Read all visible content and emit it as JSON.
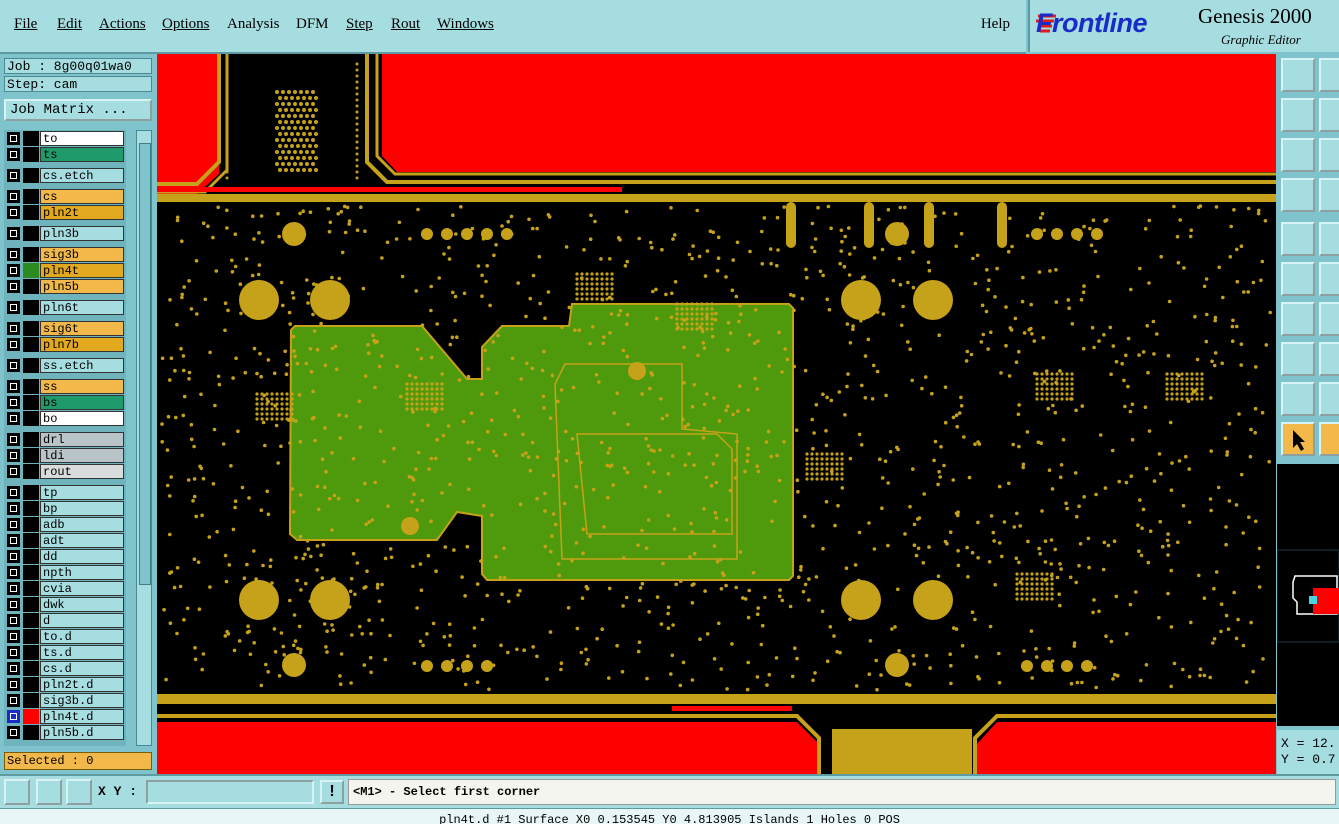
{
  "menubar": {
    "items": [
      {
        "label": "File"
      },
      {
        "label": "Edit"
      },
      {
        "label": "Actions"
      },
      {
        "label": "Options"
      },
      {
        "label": "Analysis"
      },
      {
        "label": "DFM"
      },
      {
        "label": "Step"
      },
      {
        "label": "Rout"
      },
      {
        "label": "Windows"
      }
    ],
    "help": "Help"
  },
  "brand": {
    "logo": "Frontline",
    "title": "Genesis 2000",
    "subtitle": "Graphic Editor"
  },
  "job": {
    "job_line": "Job : 8g00q01wa0",
    "step_line": "Step: cam",
    "matrix_button": "Job Matrix ..."
  },
  "layers": [
    {
      "name": "to",
      "color": "#ffffff",
      "active": false
    },
    {
      "name": "ts",
      "color": "#1f9a6a",
      "active": false
    },
    {
      "name": "cs.etch",
      "color": "#a6dde0",
      "active": false
    },
    {
      "name": "cs",
      "color": "#f2b94a",
      "active": false
    },
    {
      "name": "pln2t",
      "color": "#e2a81e",
      "active": false
    },
    {
      "name": "pln3b",
      "color": "#a6dde0",
      "active": false
    },
    {
      "name": "sig3b",
      "color": "#f2b94a",
      "active": false
    },
    {
      "name": "pln4t",
      "color": "#e2a81e",
      "active": false
    },
    {
      "name": "pln5b",
      "color": "#f2b94a",
      "active": false
    },
    {
      "name": "pln6t",
      "color": "#a6dde0",
      "active": false
    },
    {
      "name": "sig6t",
      "color": "#f2b94a",
      "active": false
    },
    {
      "name": "pln7b",
      "color": "#e2a81e",
      "active": false
    },
    {
      "name": "ss.etch",
      "color": "#a6dde0",
      "active": false
    },
    {
      "name": "ss",
      "color": "#f2b94a",
      "active": false
    },
    {
      "name": "bs",
      "color": "#1f9a6a",
      "active": false
    },
    {
      "name": "bo",
      "color": "#ffffff",
      "active": false
    },
    {
      "name": "drl",
      "color": "#b8c4c8",
      "active": false
    },
    {
      "name": "ldi",
      "color": "#b8c4c8",
      "active": false
    },
    {
      "name": "rout",
      "color": "#d8dcdc",
      "active": false
    },
    {
      "name": "tp",
      "color": "#a6dde0",
      "active": false
    },
    {
      "name": "bp",
      "color": "#a6dde0",
      "active": false
    },
    {
      "name": "adb",
      "color": "#a6dde0",
      "active": false
    },
    {
      "name": "adt",
      "color": "#a6dde0",
      "active": false
    },
    {
      "name": "dd",
      "color": "#a6dde0",
      "active": false
    },
    {
      "name": "npth",
      "color": "#a6dde0",
      "active": false
    },
    {
      "name": "cvia",
      "color": "#a6dde0",
      "active": false
    },
    {
      "name": "dwk",
      "color": "#a6dde0",
      "active": false
    },
    {
      "name": "d",
      "color": "#a6dde0",
      "active": false
    },
    {
      "name": "to.d",
      "color": "#a6dde0",
      "active": false
    },
    {
      "name": "ts.d",
      "color": "#a6dde0",
      "active": false
    },
    {
      "name": "cs.d",
      "color": "#a6dde0",
      "active": false
    },
    {
      "name": "pln2t.d",
      "color": "#a6dde0",
      "active": false
    },
    {
      "name": "sig3b.d",
      "color": "#a6dde0",
      "active": false
    },
    {
      "name": "pln4t.d",
      "color": "#a6dde0",
      "active": true
    },
    {
      "name": "pln5b.d",
      "color": "#a6dde0",
      "active": false
    }
  ],
  "selected": "Selected : 0",
  "bottom": {
    "xy_label": "X Y :",
    "xy_value": "",
    "info_button": "!",
    "prompt": "<M1> - Select first corner"
  },
  "coords": {
    "x": "X = 12.",
    "y": "Y = 0.7"
  },
  "status": "pln4t.d #1 Surface X0 0.153545 Y0 4.813905 Islands 1 Holes 0 POS",
  "colors": {
    "copper": "#c6a21a",
    "plane": "#ff0000",
    "selection": "#4e9a0c",
    "background": "#000000",
    "ui": "#a6dde0",
    "highlight": "#f2b94a"
  }
}
